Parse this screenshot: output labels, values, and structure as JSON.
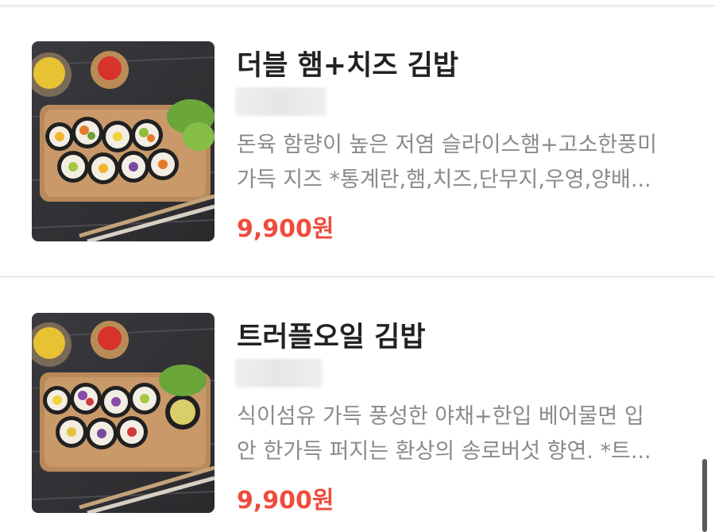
{
  "menu": {
    "items": [
      {
        "name": "더블 햄+치즈 김밥",
        "desc_line1": "돈육 함량이 높은 저염 슬라이스햄+고소한풍미",
        "desc_line2": "가득 지즈 *통계란,햄,치즈,단무지,우영,양배...",
        "price": "9,900원",
        "image": "kimbap-ham-cheese-photo"
      },
      {
        "name": "트러플오일 김밥",
        "desc_line1": "식이섬유 가득 풍성한 야채+한입 베어물면 입",
        "desc_line2": "안 한가득 퍼지는 환상의 송로버섯 향연. *트...",
        "price": "9,900원",
        "image": "kimbap-truffle-photo"
      }
    ]
  },
  "colors": {
    "price": "#ef4c3c",
    "title": "#222222",
    "desc": "#8a8a8a",
    "divider": "#eeeeee"
  }
}
